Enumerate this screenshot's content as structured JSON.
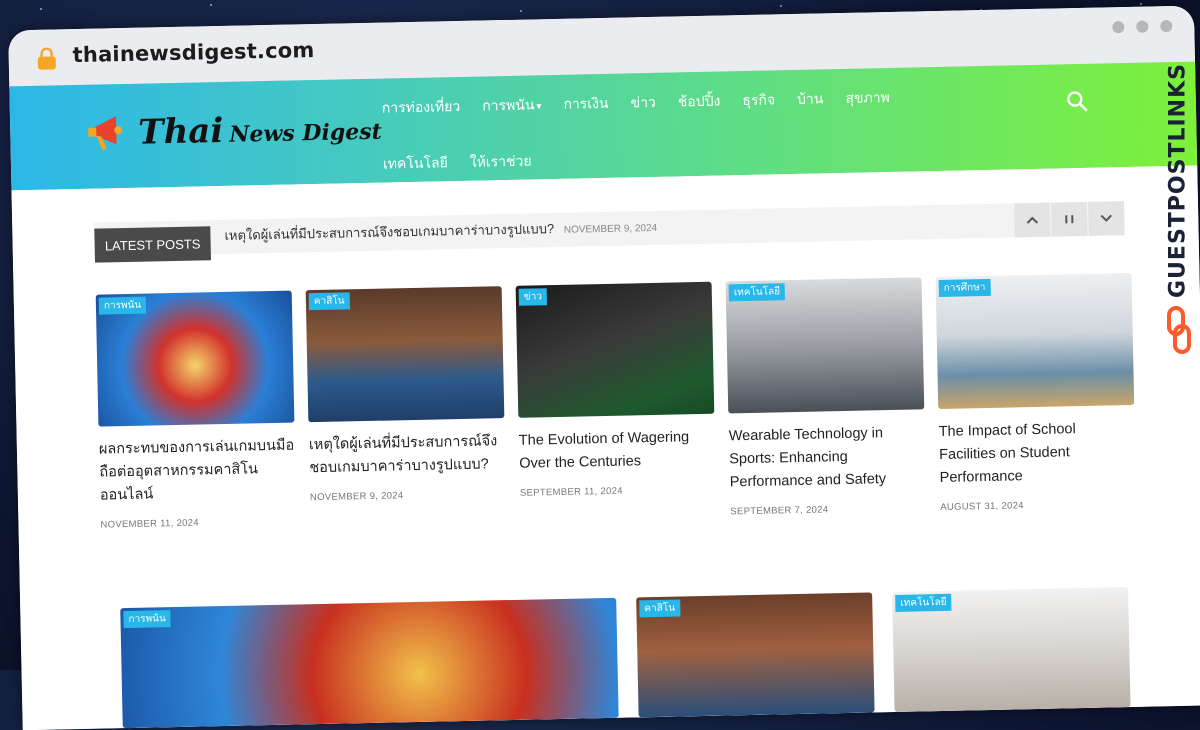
{
  "browser": {
    "url": "thainewsdigest.com"
  },
  "site": {
    "logo_thai": "Thai",
    "logo_rest": "News Digest"
  },
  "nav": {
    "row1": [
      "การท่องเที่ยว",
      "การพนัน",
      "การเงิน",
      "ข่าว",
      "ช้อปปิ้ง",
      "ธุรกิจ",
      "บ้าน",
      "สุขภาพ"
    ],
    "row2": [
      "เทคโนโลยี",
      "ให้เราช่วย"
    ]
  },
  "ticker": {
    "label": "LATEST POSTS",
    "headline": "เหตุใดผู้เล่นที่มีประสบการณ์จึงชอบเกมบาคาร่าบางรูปแบบ?",
    "date": "NOVEMBER 9, 2024"
  },
  "posts": [
    {
      "category": "การพนัน",
      "title": "ผลกระทบของการเล่นเกมบนมือถือต่ออุตสาหกรรมคาสิโนออนไลน์",
      "date": "NOVEMBER 11, 2024"
    },
    {
      "category": "คาสิโน",
      "title": "เหตุใดผู้เล่นที่มีประสบการณ์จึงชอบเกมบาคาร่าบางรูปแบบ?",
      "date": "NOVEMBER 9, 2024"
    },
    {
      "category": "ข่าว",
      "title": "The Evolution of Wagering Over the Centuries",
      "date": "SEPTEMBER 11, 2024"
    },
    {
      "category": "เทคโนโลยี",
      "title": "Wearable Technology in Sports: Enhancing Performance and Safety",
      "date": "SEPTEMBER 7, 2024"
    },
    {
      "category": "การศึกษา",
      "title": "The Impact of School Facilities on Student Performance",
      "date": "AUGUST 31, 2024"
    }
  ],
  "featured": [
    {
      "category": "การพนัน"
    },
    {
      "category": "คาสิโน"
    },
    {
      "category": "เทคโนโลยี"
    }
  ],
  "watermark": {
    "text": "GUESTPOSTLINKS"
  },
  "colors": {
    "header_start": "#2cb7e8",
    "header_end": "#7ef13a",
    "category_badge": "#29b6e8"
  }
}
